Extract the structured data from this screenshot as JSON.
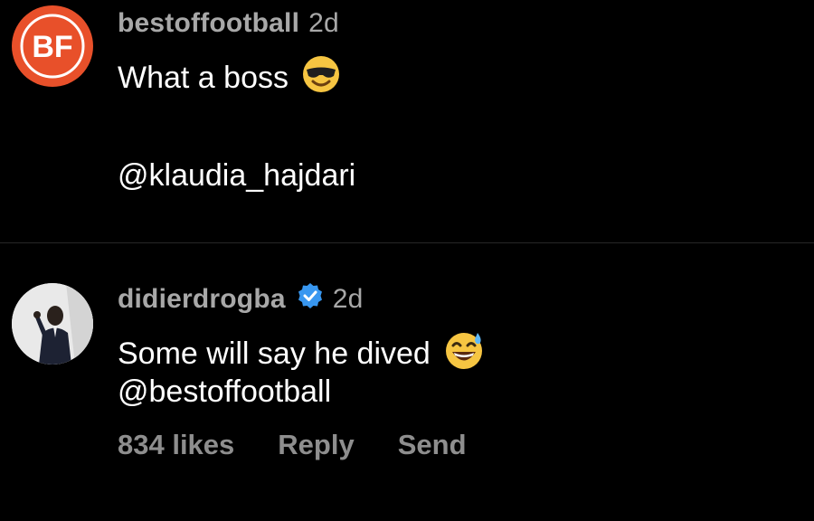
{
  "comments": [
    {
      "username": "bestoffootball",
      "time": "2d",
      "avatar_text": "BF",
      "text_line1": "What a boss",
      "emoji1": "smiling-face-with-sunglasses",
      "text_line2": "@klaudia_hajdari"
    },
    {
      "username": "didierdrogba",
      "verified": true,
      "time": "2d",
      "text_line1": "Some will say he dived",
      "emoji1": "grinning-face-with-sweat",
      "text_line2": "@bestoffootball",
      "likes": "834 likes",
      "reply_label": "Reply",
      "send_label": "Send"
    }
  ],
  "colors": {
    "background": "#000000",
    "muted_text": "#a8a8a8",
    "brand_orange": "#e8502a",
    "verified_blue": "#3897f0"
  }
}
